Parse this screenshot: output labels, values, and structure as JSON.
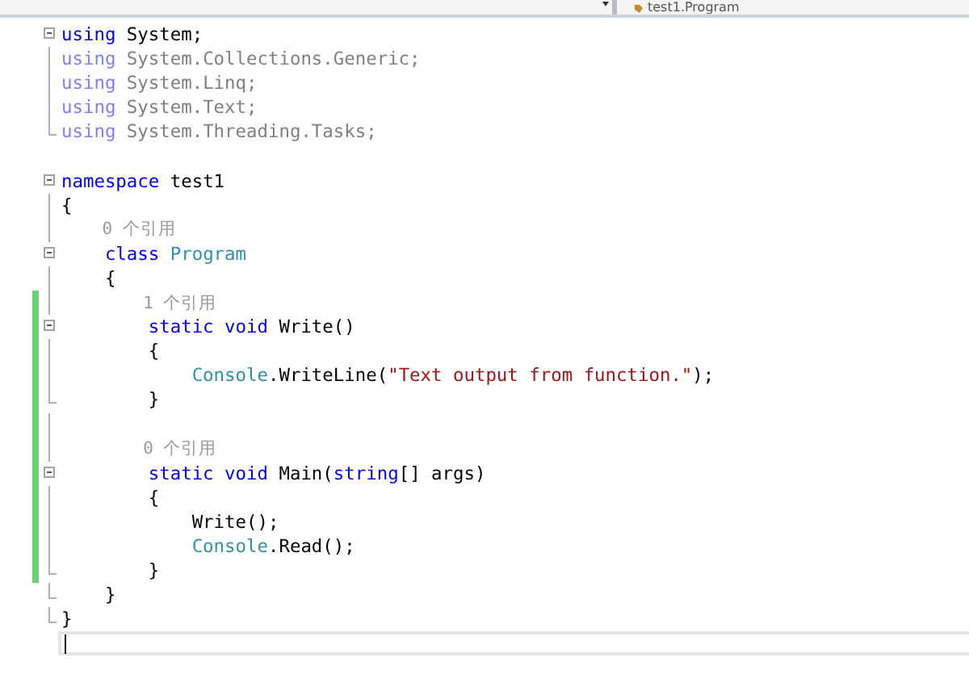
{
  "navigation_bar": {
    "member_dropdown": {
      "text": "test1.Program"
    }
  },
  "lines": [
    {
      "kind": "fold-start",
      "changed": false,
      "current": false,
      "tokens": [
        {
          "kind": "keyword",
          "text": "using"
        },
        {
          "kind": "plain",
          "text": " System;"
        }
      ]
    },
    {
      "kind": "fold-line",
      "changed": false,
      "current": false,
      "tokens": [
        {
          "kind": "keyword-dim",
          "text": "using"
        },
        {
          "kind": "plain-dim",
          "text": " System.Collections.Generic;"
        }
      ]
    },
    {
      "kind": "fold-line",
      "changed": false,
      "current": false,
      "tokens": [
        {
          "kind": "keyword-dim",
          "text": "using"
        },
        {
          "kind": "plain-dim",
          "text": " System.Linq;"
        }
      ]
    },
    {
      "kind": "fold-line",
      "changed": false,
      "current": false,
      "tokens": [
        {
          "kind": "keyword-dim",
          "text": "using"
        },
        {
          "kind": "plain-dim",
          "text": " System.Text;"
        }
      ]
    },
    {
      "kind": "fold-end",
      "changed": false,
      "current": false,
      "tokens": [
        {
          "kind": "keyword-dim",
          "text": "using"
        },
        {
          "kind": "plain-dim",
          "text": " System.Threading.Tasks;"
        }
      ]
    },
    {
      "kind": "plain",
      "changed": false,
      "current": false
    },
    {
      "kind": "fold-start",
      "changed": false,
      "current": false,
      "tokens": [
        {
          "kind": "keyword",
          "text": "namespace"
        },
        {
          "kind": "plain",
          "text": " test1"
        }
      ]
    },
    {
      "kind": "fold-line",
      "changed": false,
      "current": false,
      "tokens": [
        {
          "kind": "plain",
          "text": "{"
        }
      ]
    },
    {
      "kind": "fold-line",
      "changed": false,
      "current": false,
      "tokens": [
        {
          "kind": "lens",
          "text": "    0 个引用"
        }
      ]
    },
    {
      "kind": "fold-start",
      "changed": false,
      "current": false,
      "tokens": [
        {
          "kind": "keyword",
          "text": "    class"
        },
        {
          "kind": "type",
          "text": " Program"
        }
      ]
    },
    {
      "kind": "fold-line",
      "changed": false,
      "current": false,
      "tokens": [
        {
          "kind": "plain",
          "text": "    {"
        }
      ]
    },
    {
      "kind": "fold-line",
      "changed": true,
      "current": false,
      "tokens": [
        {
          "kind": "lens",
          "text": "        1 个引用"
        }
      ]
    },
    {
      "kind": "fold-start",
      "changed": true,
      "current": false,
      "tokens": [
        {
          "kind": "keyword",
          "text": "        static void"
        },
        {
          "kind": "plain",
          "text": " Write()"
        }
      ]
    },
    {
      "kind": "fold-line",
      "changed": true,
      "current": false,
      "tokens": [
        {
          "kind": "plain",
          "text": "        {"
        }
      ]
    },
    {
      "kind": "fold-line",
      "changed": true,
      "current": false,
      "tokens": [
        {
          "kind": "type",
          "text": "            Console"
        },
        {
          "kind": "plain",
          "text": ".WriteLine("
        },
        {
          "kind": "string",
          "text": "\"Text output from function.\""
        },
        {
          "kind": "plain",
          "text": ");"
        }
      ]
    },
    {
      "kind": "fold-end",
      "changed": true,
      "current": false,
      "tokens": [
        {
          "kind": "plain",
          "text": "        }"
        }
      ]
    },
    {
      "kind": "fold-line",
      "changed": true,
      "current": false
    },
    {
      "kind": "fold-line",
      "changed": true,
      "current": false,
      "tokens": [
        {
          "kind": "lens",
          "text": "        0 个引用"
        }
      ]
    },
    {
      "kind": "fold-start",
      "changed": true,
      "current": false,
      "tokens": [
        {
          "kind": "keyword",
          "text": "        static void"
        },
        {
          "kind": "plain",
          "text": " Main("
        },
        {
          "kind": "keyword",
          "text": "string"
        },
        {
          "kind": "plain",
          "text": "[] args)"
        }
      ]
    },
    {
      "kind": "fold-line",
      "changed": true,
      "current": false,
      "tokens": [
        {
          "kind": "plain",
          "text": "        {"
        }
      ]
    },
    {
      "kind": "fold-line",
      "changed": true,
      "current": false,
      "tokens": [
        {
          "kind": "plain",
          "text": "            Write();"
        }
      ]
    },
    {
      "kind": "fold-line",
      "changed": true,
      "current": false,
      "tokens": [
        {
          "kind": "type",
          "text": "            Console"
        },
        {
          "kind": "plain",
          "text": ".Read();"
        }
      ]
    },
    {
      "kind": "fold-end",
      "changed": true,
      "current": false,
      "tokens": [
        {
          "kind": "plain",
          "text": "        }"
        }
      ]
    },
    {
      "kind": "fold-end",
      "changed": false,
      "current": false,
      "tokens": [
        {
          "kind": "plain",
          "text": "    }"
        }
      ]
    },
    {
      "kind": "fold-end",
      "changed": false,
      "current": false,
      "tokens": [
        {
          "kind": "plain",
          "text": "}"
        }
      ]
    },
    {
      "kind": "plain",
      "changed": false,
      "current": true
    }
  ]
}
